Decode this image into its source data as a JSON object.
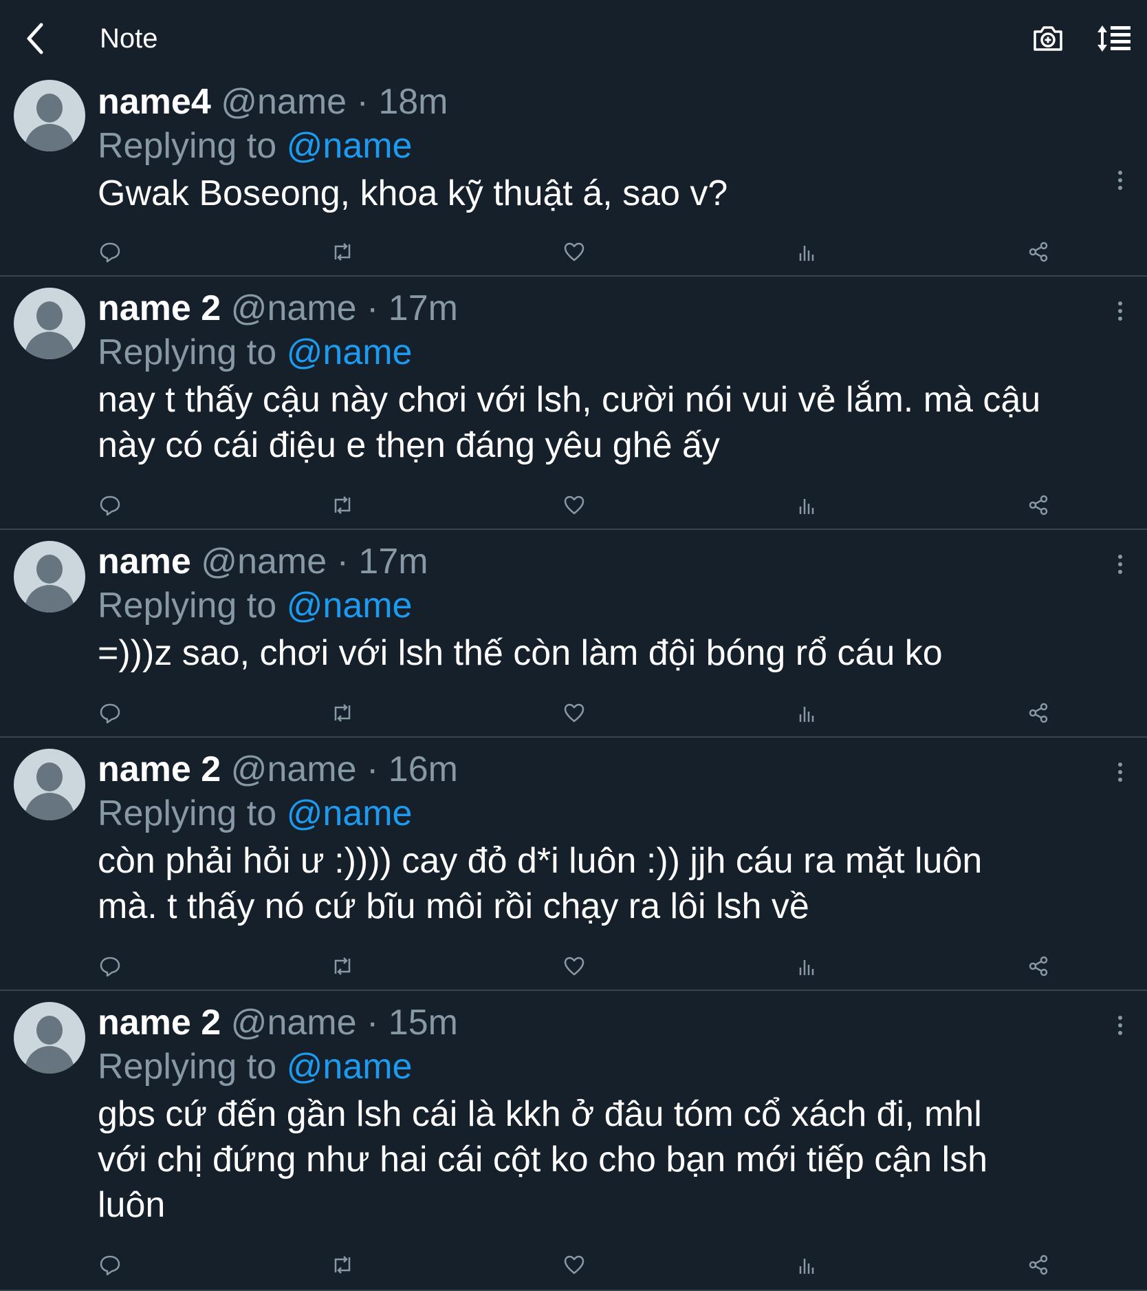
{
  "header": {
    "title": "Note",
    "back_icon": "chevron-left-icon",
    "camera_icon": "camera-plus-icon",
    "sort_icon": "sort-lines-icon"
  },
  "colors": {
    "background": "#15202b",
    "divider": "#38444d",
    "secondary_text": "#8899a6",
    "mention": "#1d9bf0"
  },
  "tweets": [
    {
      "name": "name4",
      "handle": "@name",
      "sep": "·",
      "time": "18m",
      "replying_prefix": "Replying to",
      "replying_to": "@name",
      "text": "Gwak Boseong, khoa kỹ thuật á, sao v?"
    },
    {
      "name": "name 2",
      "handle": "@name",
      "sep": "·",
      "time": "17m",
      "replying_prefix": "Replying to",
      "replying_to": "@name",
      "text": "nay t thấy cậu này chơi với lsh, cười nói vui vẻ lắm. mà cậu\nnày có cái điệu e thẹn đáng yêu ghê ấy"
    },
    {
      "name": "name",
      "handle": "@name",
      "sep": "·",
      "time": "17m",
      "replying_prefix": "Replying to",
      "replying_to": "@name",
      "text": "=)))z sao, chơi với lsh thế còn làm đội bóng rổ cáu ko"
    },
    {
      "name": "name 2",
      "handle": "@name",
      "sep": "·",
      "time": "16m",
      "replying_prefix": "Replying to",
      "replying_to": "@name",
      "text": "còn phải hỏi ư :)))) cay đỏ d*i luôn :)) jjh cáu ra mặt luôn\nmà. t thấy nó cứ bĩu môi rồi chạy ra lôi lsh về"
    },
    {
      "name": "name 2",
      "handle": "@name",
      "sep": "·",
      "time": "15m",
      "replying_prefix": "Replying to",
      "replying_to": "@name",
      "text": "gbs cứ đến gần lsh cái là kkh ở đâu tóm cổ xách đi, mhl\nvới chị đứng như hai cái cột ko cho bạn mới tiếp cận lsh\nluôn"
    }
  ],
  "action_icons": [
    "reply-icon",
    "retweet-icon",
    "like-icon",
    "analytics-icon",
    "share-icon"
  ]
}
